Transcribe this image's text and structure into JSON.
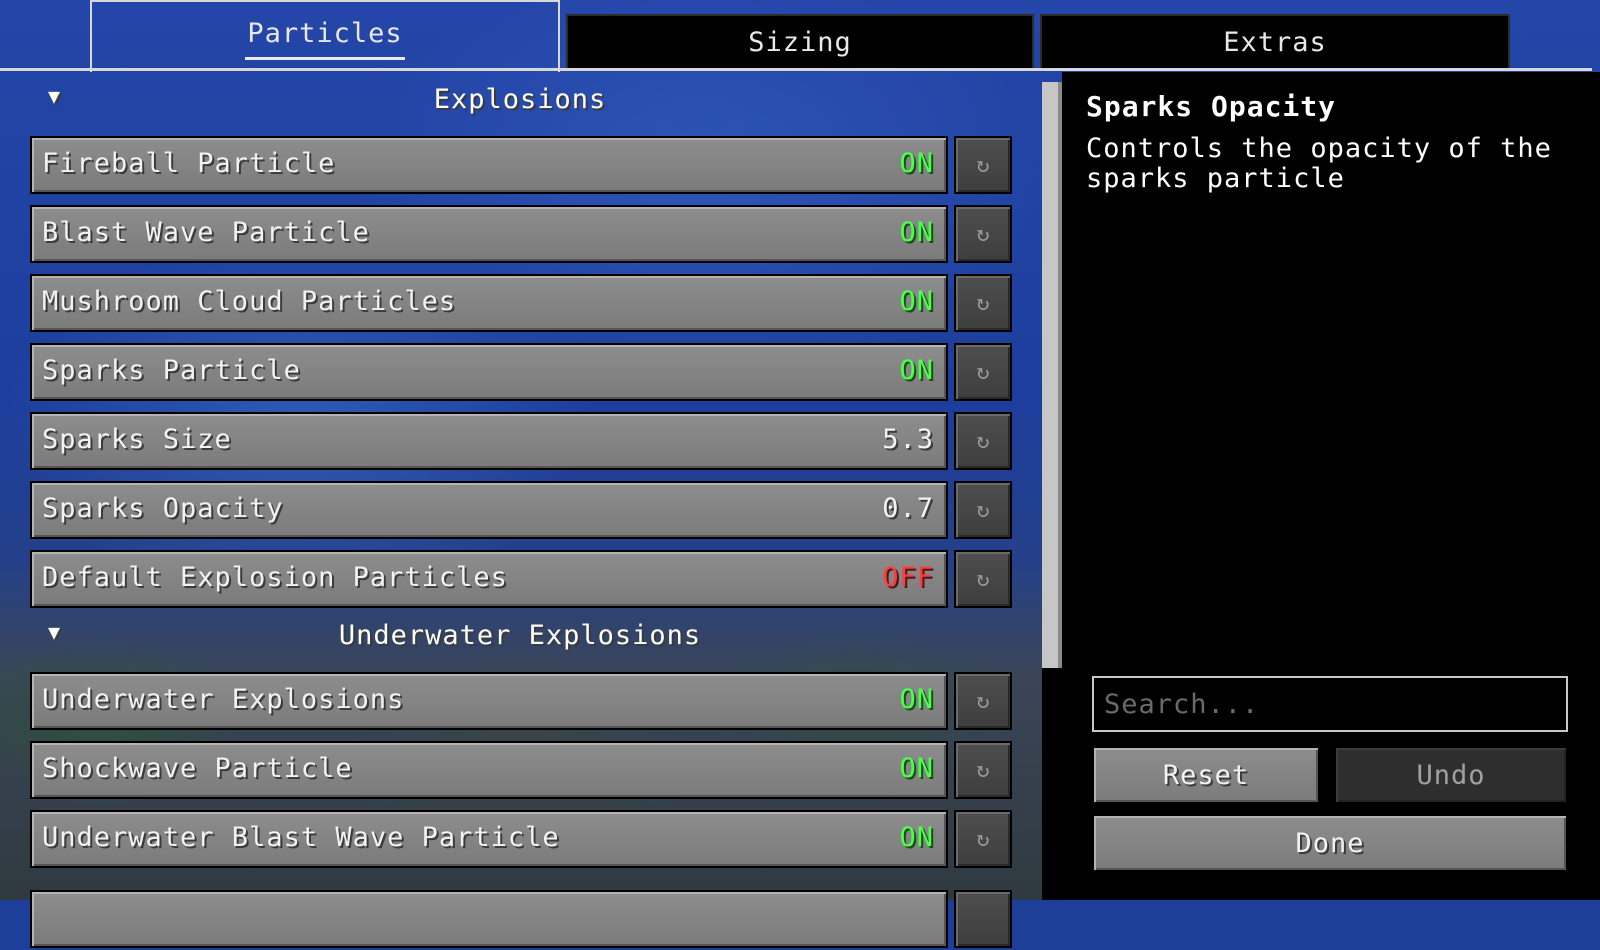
{
  "tabs": [
    {
      "label": "Particles",
      "active": true
    },
    {
      "label": "Sizing",
      "active": false
    },
    {
      "label": "Extras",
      "active": false
    }
  ],
  "sections": [
    {
      "title": "Explosions",
      "expanded": true,
      "options": [
        {
          "label": "Fireball Particle",
          "value": "ON",
          "state": "on"
        },
        {
          "label": "Blast Wave Particle",
          "value": "ON",
          "state": "on"
        },
        {
          "label": "Mushroom Cloud Particles",
          "value": "ON",
          "state": "on"
        },
        {
          "label": "Sparks Particle",
          "value": "ON",
          "state": "on"
        },
        {
          "label": "Sparks Size",
          "value": "5.3",
          "state": "number"
        },
        {
          "label": "Sparks Opacity",
          "value": "0.7",
          "state": "number"
        },
        {
          "label": "Default Explosion Particles",
          "value": "OFF",
          "state": "off"
        }
      ]
    },
    {
      "title": "Underwater Explosions",
      "expanded": true,
      "options": [
        {
          "label": "Underwater Explosions",
          "value": "ON",
          "state": "on"
        },
        {
          "label": "Shockwave Particle",
          "value": "ON",
          "state": "on"
        },
        {
          "label": "Underwater Blast Wave Particle",
          "value": "ON",
          "state": "on"
        }
      ]
    }
  ],
  "reset_icon": "↻",
  "collapse_icon": "▼",
  "description": {
    "title": "Sparks Opacity",
    "text": "Controls the opacity of the sparks particle"
  },
  "search": {
    "placeholder": "Search...",
    "value": ""
  },
  "buttons": {
    "reset": "Reset",
    "undo": "Undo",
    "done": "Done"
  },
  "colors": {
    "on": "#4cff4c",
    "off": "#ff3b3b"
  }
}
